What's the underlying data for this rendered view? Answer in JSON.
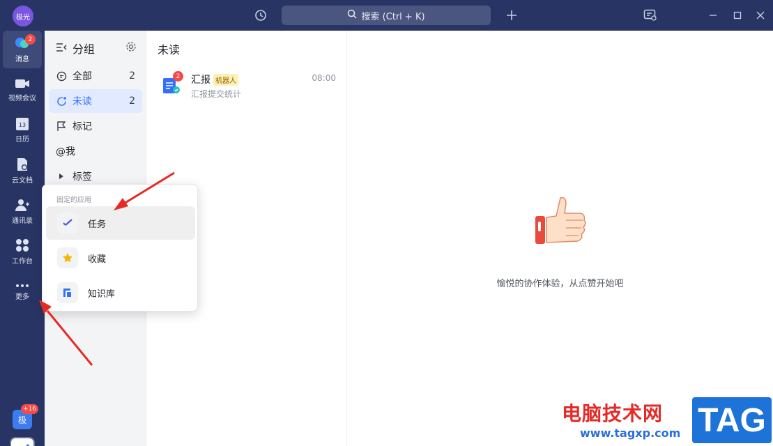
{
  "titlebar": {
    "avatar_text": "极光",
    "search_placeholder": "搜索 (Ctrl + K)"
  },
  "nav": {
    "items": [
      {
        "label": "消息",
        "icon": "chat-bubble-icon",
        "badge": "2"
      },
      {
        "label": "视频会议",
        "icon": "video-camera-icon"
      },
      {
        "label": "日历",
        "icon": "calendar-icon",
        "day": "13"
      },
      {
        "label": "云文档",
        "icon": "cloud-doc-icon"
      },
      {
        "label": "通讯录",
        "icon": "contacts-icon"
      },
      {
        "label": "工作台",
        "icon": "workbench-icon"
      },
      {
        "label": "更多",
        "icon": "more-dots-icon"
      }
    ],
    "user_tile": {
      "text": "极",
      "badge": "+16"
    }
  },
  "groups": {
    "title": "分组",
    "items": [
      {
        "label": "全部",
        "count": "2",
        "icon": "chat-icon"
      },
      {
        "label": "未读",
        "count": "2",
        "icon": "unread-icon"
      },
      {
        "label": "标记",
        "count": "",
        "icon": "flag-icon"
      },
      {
        "label": "@我",
        "count": "",
        "icon": "at-icon"
      },
      {
        "label": "标签",
        "count": "",
        "icon": "triangle-icon"
      }
    ]
  },
  "message_list": {
    "title": "未读",
    "messages": [
      {
        "name": "汇报",
        "tag": "机器人",
        "time": "08:00",
        "preview": "汇报提交统计",
        "badge": "2"
      }
    ]
  },
  "main": {
    "empty_text": "愉悦的协作体验，从点赞开始吧"
  },
  "popup": {
    "heading": "固定的应用",
    "items": [
      {
        "label": "任务",
        "icon": "task-check-icon"
      },
      {
        "label": "收藏",
        "icon": "star-icon"
      },
      {
        "label": "知识库",
        "icon": "knowledge-base-icon"
      }
    ]
  },
  "watermark": {
    "cn": "电脑技术网",
    "url": "www.tagxp.com",
    "tag": "TAG"
  },
  "colors": {
    "sidebar": "#283564",
    "accent": "#3370ff",
    "badge": "#f54a45"
  }
}
